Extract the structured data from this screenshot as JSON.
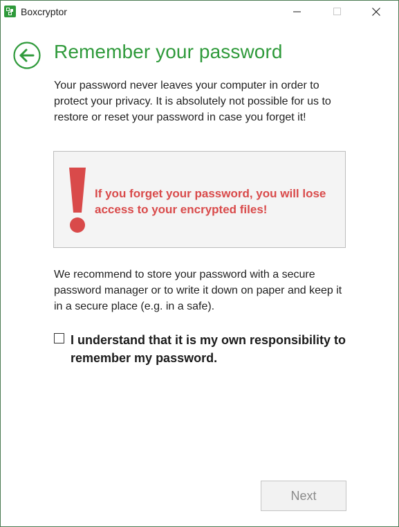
{
  "window": {
    "title": "Boxcryptor",
    "accent_color": "#2f9a3b",
    "warning_color": "#d94a4a"
  },
  "page": {
    "title": "Remember your password",
    "intro": "Your password never leaves your computer in order to protect your privacy. It is absolutely not possible for us to restore or reset your password in case you forget it!",
    "warning": "If you forget your password, you will lose access to your encrypted files!",
    "recommendation": "We recommend to store your password with a secure password manager or to write it down on paper and keep it in a secure place (e.g. in a safe).",
    "checkbox_label": "I understand that it is my own responsibility to remember my password.",
    "checkbox_checked": false
  },
  "footer": {
    "next_label": "Next",
    "next_enabled": false
  }
}
